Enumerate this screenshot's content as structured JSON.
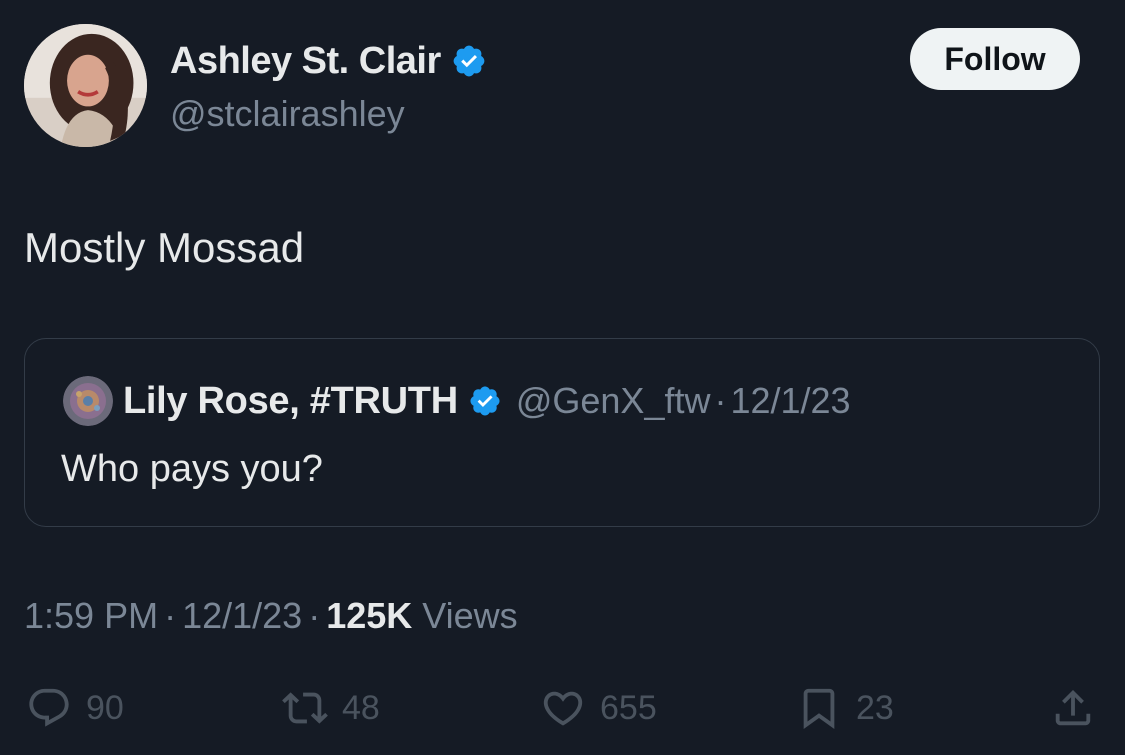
{
  "author": {
    "name": "Ashley St. Clair",
    "handle": "@stclairashley",
    "verified": true
  },
  "follow_label": "Follow",
  "tweet_text": "Mostly Mossad",
  "quote": {
    "name": "Lily Rose, #TRUTH",
    "handle": "@GenX_ftw",
    "separator": "·",
    "date": "12/1/23",
    "text": "Who pays you?",
    "verified": true
  },
  "meta": {
    "time": "1:59 PM",
    "separator": "·",
    "date": "12/1/23",
    "views_count": "125K",
    "views_label": "Views"
  },
  "actions": {
    "replies": "90",
    "reposts": "48",
    "likes": "655",
    "bookmarks": "23"
  },
  "colors": {
    "background": "#151b25",
    "text_primary": "#e7e9ea",
    "text_secondary": "#7b8796",
    "verified_blue": "#1d9bf0",
    "action_icon": "#4a535e",
    "follow_bg": "#eff3f4"
  },
  "icons": {
    "verified": "verified-badge-icon",
    "reply": "reply-icon",
    "repost": "repost-icon",
    "like": "heart-icon",
    "bookmark": "bookmark-icon",
    "share": "share-icon"
  }
}
